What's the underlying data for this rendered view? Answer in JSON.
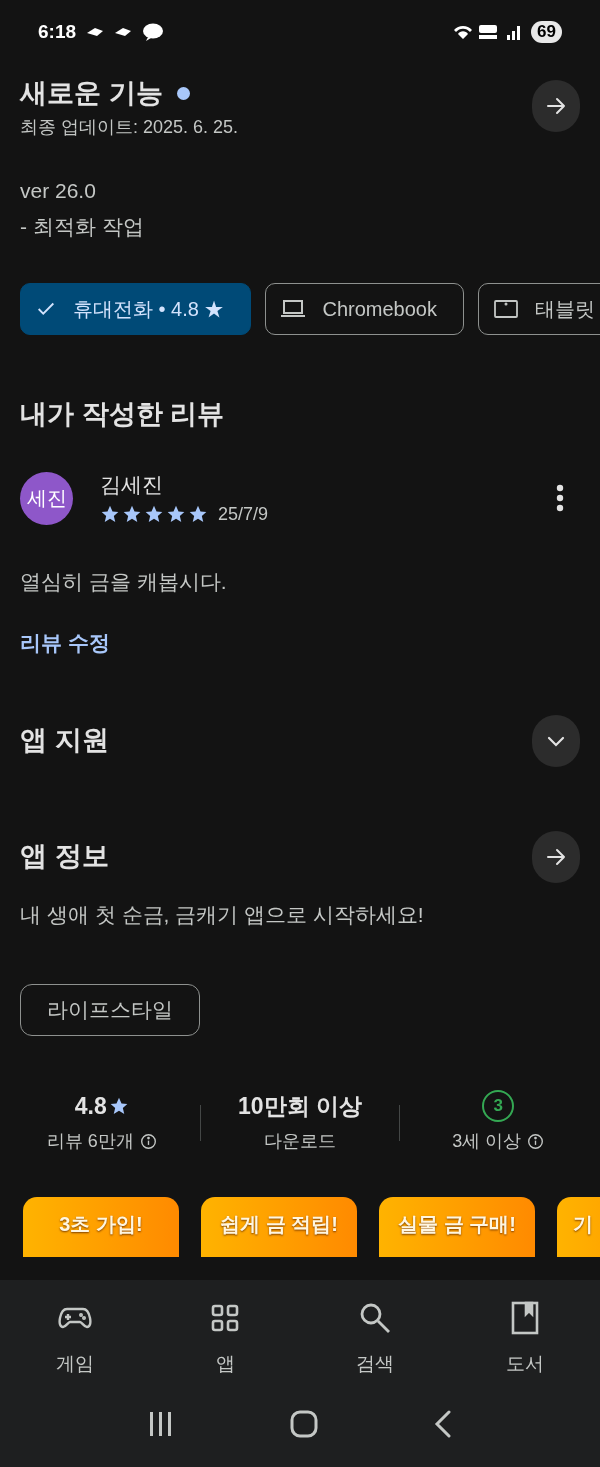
{
  "status_bar": {
    "time": "6:18",
    "battery": "69"
  },
  "whats_new": {
    "title": "새로운 기능",
    "updated": "최종 업데이트: 2025. 6. 25.",
    "notes": [
      "ver 26.0",
      "- 최적화 작업"
    ]
  },
  "devices": [
    {
      "label": "휴대전화 • 4.8 ★",
      "selected": true
    },
    {
      "kind": "laptop",
      "label": "Chromebook",
      "selected": false
    },
    {
      "kind": "tablet",
      "label": "태블릿",
      "selected": false
    }
  ],
  "my_review": {
    "heading": "내가 작성한 리뷰",
    "avatar": "세진",
    "author": "김세진",
    "stars": 5,
    "date": "25/7/9",
    "text": "열심히 금을 캐봅시다.",
    "edit_link": "리뷰 수정"
  },
  "app_support": {
    "title": "앱 지원",
    "expanded": false
  },
  "app_info": {
    "title": "앱 정보",
    "description": "내 생애 첫 순금, 금캐기 앱으로 시작하세요!",
    "category": "라이프스타일"
  },
  "stats": [
    {
      "kind": "rating",
      "value": "4.8",
      "label": "리뷰 6만개"
    },
    {
      "kind": "downloads",
      "value": "10만회 이상",
      "label": "다운로드"
    },
    {
      "kind": "age",
      "value": "3",
      "label": "3세 이상"
    }
  ],
  "screenshots": [
    "3초 가입!",
    "쉽게 금 적립!",
    "실물 금 구매!",
    "기"
  ],
  "bottom_nav": [
    {
      "kind": "games",
      "label": "게임"
    },
    {
      "kind": "apps",
      "label": "앱"
    },
    {
      "kind": "search",
      "label": "검색"
    },
    {
      "kind": "books",
      "label": "도서"
    }
  ]
}
